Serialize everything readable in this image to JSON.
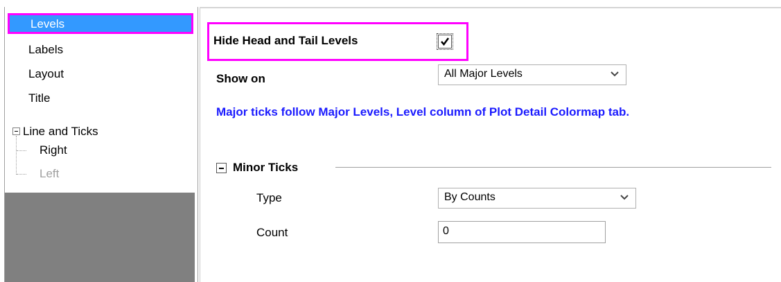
{
  "tree": {
    "items": [
      {
        "label": "Levels"
      },
      {
        "label": "Labels"
      },
      {
        "label": "Layout"
      },
      {
        "label": "Title"
      },
      {
        "label": "Line and Ticks"
      },
      {
        "label": "Right"
      },
      {
        "label": "Left"
      }
    ],
    "selected": "Levels"
  },
  "options": {
    "hide_head_tail": {
      "label": "Hide Head and Tail Levels",
      "checked": true
    },
    "show_on": {
      "label": "Show on",
      "value": "All Major Levels"
    },
    "note": "Major ticks follow Major Levels, Level column of Plot Detail Colormap tab.",
    "minor_ticks": {
      "title": "Minor Ticks",
      "type": {
        "label": "Type",
        "value": "By Counts"
      },
      "count": {
        "label": "Count",
        "value": "0"
      }
    }
  },
  "colors": {
    "highlight": "#ff00ff",
    "selection": "#3399ff",
    "note_text": "#1a1aff"
  }
}
